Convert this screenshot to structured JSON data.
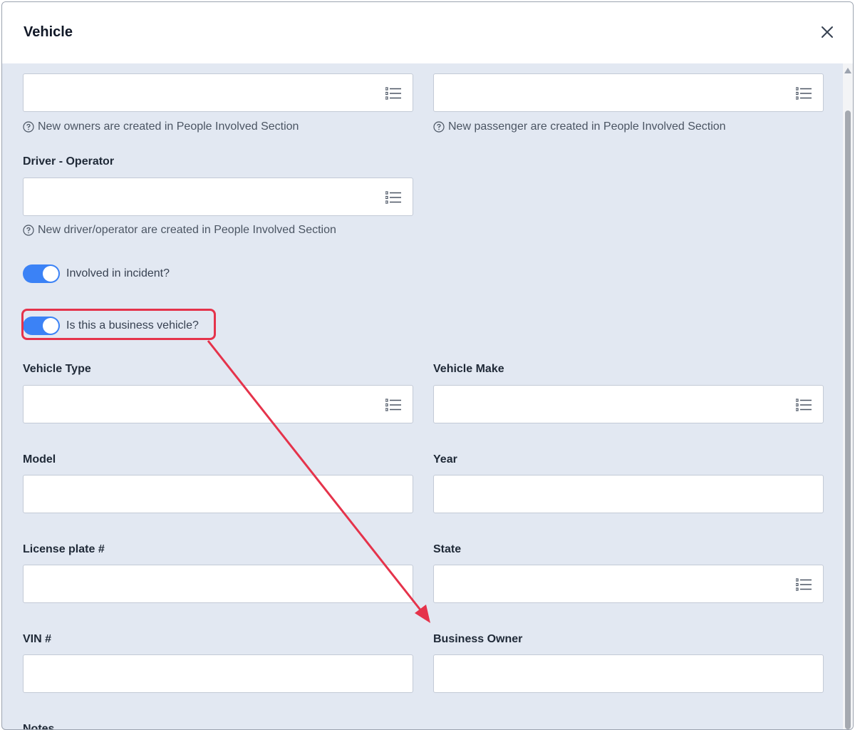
{
  "modal": {
    "title": "Vehicle"
  },
  "hints": {
    "owners": "New owners are created in People Involved Section",
    "passenger": "New passenger are created in People Involved Section",
    "driver": "New driver/operator are created in People Involved Section"
  },
  "labels": {
    "driver_operator": "Driver - Operator",
    "vehicle_type": "Vehicle Type",
    "vehicle_make": "Vehicle Make",
    "model": "Model",
    "year": "Year",
    "license_plate": "License plate #",
    "state": "State",
    "vin": "VIN #",
    "business_owner": "Business Owner",
    "notes": "Notes"
  },
  "toggles": {
    "involved": {
      "label": "Involved in incident?",
      "on": true
    },
    "business": {
      "label": "Is this a business vehicle?",
      "on": true
    }
  },
  "colors": {
    "accent": "#3b82f6",
    "annotation": "#e5334b",
    "background": "#e2e8f2"
  },
  "icons": {
    "close": "close-icon",
    "list": "list-icon",
    "help": "help-circle-icon"
  }
}
